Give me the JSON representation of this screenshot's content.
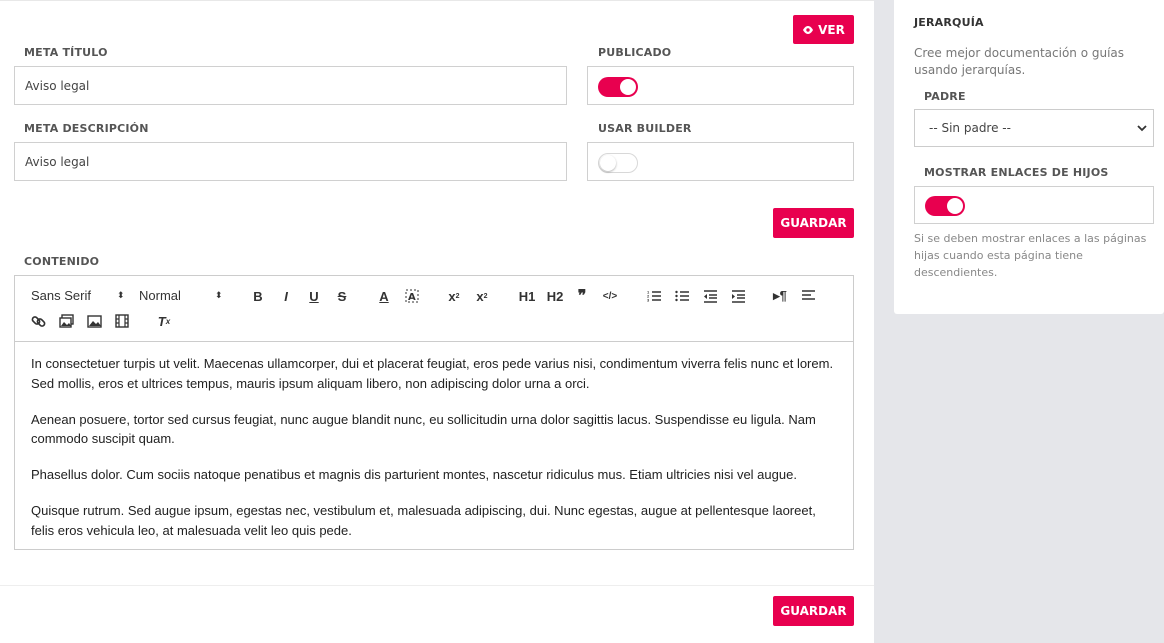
{
  "buttons": {
    "view": "VER",
    "save_top": "GUARDAR",
    "save_bottom": "GUARDAR"
  },
  "meta_title": {
    "label": "META TÍTULO",
    "value": "Aviso legal"
  },
  "meta_description": {
    "label": "META DESCRIPCIÓN",
    "value": "Aviso legal"
  },
  "published": {
    "label": "PUBLICADO",
    "on": true
  },
  "use_builder": {
    "label": "USAR BUILDER",
    "on": false
  },
  "content": {
    "label": "CONTENIDO",
    "toolbar": {
      "font": "Sans Serif",
      "size": "Normal",
      "h1": "H1",
      "h2": "H2"
    },
    "paragraphs": [
      "In consectetuer turpis ut velit. Maecenas ullamcorper, dui et placerat feugiat, eros pede varius nisi, condimentum viverra felis nunc et lorem. Sed mollis, eros et ultrices tempus, mauris ipsum aliquam libero, non adipiscing dolor urna a orci.",
      "Aenean posuere, tortor sed cursus feugiat, nunc augue blandit nunc, eu sollicitudin urna dolor sagittis lacus. Suspendisse eu ligula. Nam commodo suscipit quam.",
      "Phasellus dolor. Cum sociis natoque penatibus et magnis dis parturient montes, nascetur ridiculus mus. Etiam ultricies nisi vel augue.",
      "Quisque rutrum. Sed augue ipsum, egestas nec, vestibulum et, malesuada adipiscing, dui. Nunc egestas, augue at pellentesque laoreet, felis eros vehicula leo, at malesuada velit leo quis pede."
    ]
  },
  "hierarchy": {
    "title": "JERARQUÍA",
    "description": "Cree mejor documentación o guías usando jerarquías.",
    "parent_label": "PADRE",
    "parent_value": "-- Sin padre --",
    "show_children_label": "MOSTRAR ENLACES DE HIJOS",
    "show_children_on": true,
    "show_children_help": "Si se deben mostrar enlaces a las páginas hijas cuando esta página tiene descendientes."
  },
  "colors": {
    "accent": "#e8004f",
    "sidebar_bg": "#e5e6ea"
  }
}
